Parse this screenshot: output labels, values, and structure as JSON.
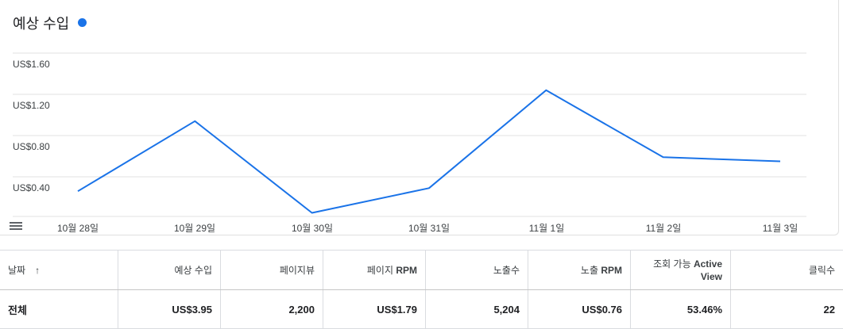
{
  "chart": {
    "title": "예상 수입",
    "series_color": "#1a73e8",
    "menu_icon": "hamburger-menu-icon"
  },
  "chart_data": {
    "type": "line",
    "categories": [
      "10월 28일",
      "10월 29일",
      "10월 30일",
      "10월 31일",
      "11월 1일",
      "11월 2일",
      "11월 3일"
    ],
    "values": [
      0.26,
      0.94,
      0.05,
      0.29,
      1.24,
      0.59,
      0.55
    ],
    "y_ticks": [
      "US$0.40",
      "US$0.80",
      "US$1.20",
      "US$1.60"
    ],
    "ylim": [
      0,
      1.8
    ],
    "grid": true
  },
  "table": {
    "headers": [
      {
        "label": "날짜",
        "sort_icon": "arrow-up-icon",
        "bold_part": ""
      },
      {
        "label": "예상 수입",
        "bold_part": ""
      },
      {
        "label": "페이지뷰",
        "bold_part": ""
      },
      {
        "label": "페이지 ",
        "bold_part": "RPM"
      },
      {
        "label": "노출수",
        "bold_part": ""
      },
      {
        "label": "노출 ",
        "bold_part": "RPM"
      },
      {
        "label": "조회 가능 ",
        "bold_part": "Active View"
      },
      {
        "label": "클릭수",
        "bold_part": ""
      }
    ],
    "total_row": [
      "전체",
      "US$3.95",
      "2,200",
      "US$1.79",
      "5,204",
      "US$0.76",
      "53.46%",
      "22"
    ]
  }
}
